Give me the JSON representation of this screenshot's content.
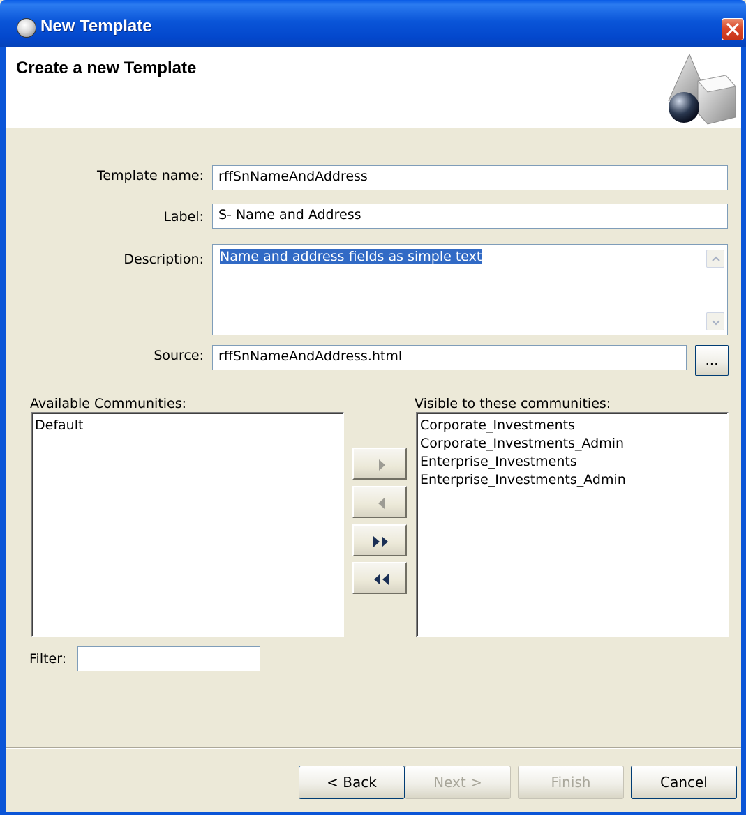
{
  "window": {
    "title": "New Template"
  },
  "banner": {
    "title": "Create a new Template"
  },
  "form": {
    "template_name": {
      "label": "Template name:",
      "value": "rffSnNameAndAddress"
    },
    "label_field": {
      "label": "Label:",
      "value": "S- Name and Address"
    },
    "description": {
      "label": "Description:",
      "value": "Name and address fields as simple text"
    },
    "source": {
      "label": "Source:",
      "value": "rffSnNameAndAddress.html",
      "browse_label": "..."
    }
  },
  "communities": {
    "available_label": "Available Communities:",
    "available": [
      "Default"
    ],
    "visible_label": "Visible to these communities:",
    "visible": [
      "Corporate_Investments",
      "Corporate_Investments_Admin",
      "Enterprise_Investments",
      "Enterprise_Investments_Admin"
    ],
    "filter_label": "Filter:",
    "filter_value": ""
  },
  "buttons": {
    "back": "< Back",
    "next": "Next >",
    "finish": "Finish",
    "cancel": "Cancel"
  },
  "colors": {
    "title_bar": "#0a55d8",
    "selection": "#316ac5",
    "dialog_bg": "#ece9d8"
  }
}
